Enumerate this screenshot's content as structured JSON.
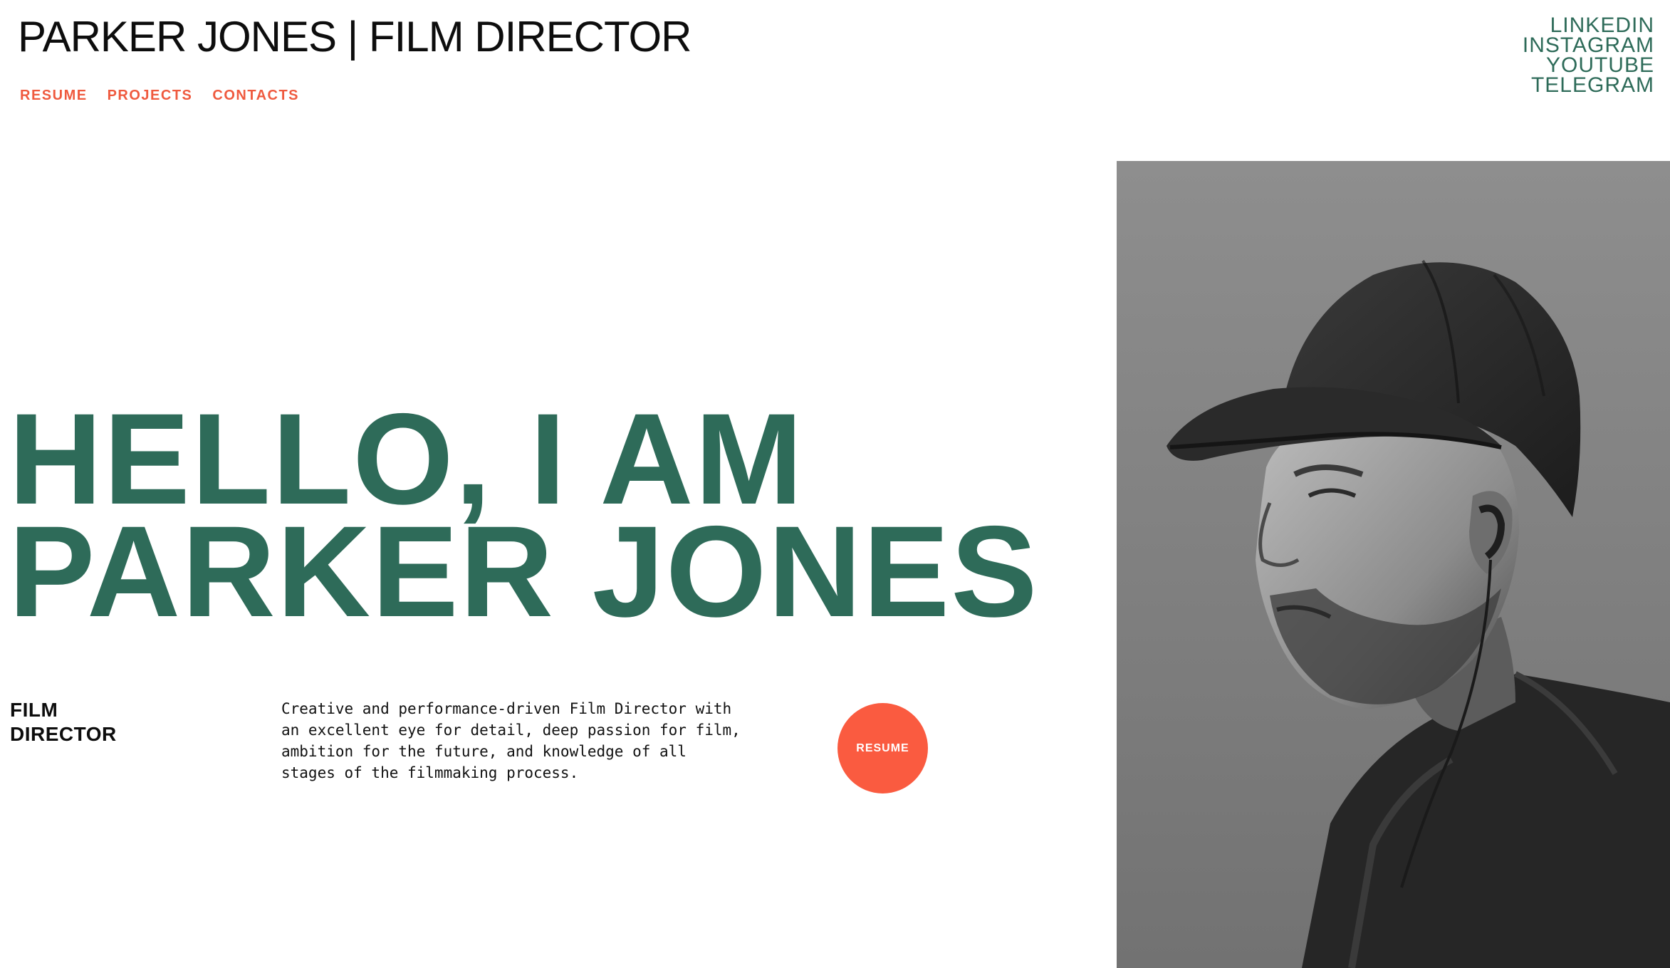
{
  "header": {
    "site_title": "PARKER JONES | FILM DIRECTOR"
  },
  "nav": {
    "items": [
      {
        "label": "RESUME"
      },
      {
        "label": "PROJECTS"
      },
      {
        "label": "CONTACTS"
      }
    ]
  },
  "social": {
    "items": [
      {
        "label": "LINKEDIN"
      },
      {
        "label": "INSTAGRAM"
      },
      {
        "label": "YOUTUBE"
      },
      {
        "label": "TELEGRAM"
      }
    ]
  },
  "hero": {
    "heading_line1": "HELLO, I AM",
    "heading_line2": "PARKER JONES",
    "role_line1": "FILM",
    "role_line2": "DIRECTOR",
    "bio": "Creative and performance-driven Film Director with an excellent eye for detail, deep passion for film, ambition for the future, and knowledge of all stages of the filmmaking process.",
    "resume_button": "RESUME"
  },
  "colors": {
    "accent_green": "#2e6b59",
    "accent_orange": "#fa5b40",
    "text_dark": "#0d0d0d",
    "background": "#ffffff"
  }
}
